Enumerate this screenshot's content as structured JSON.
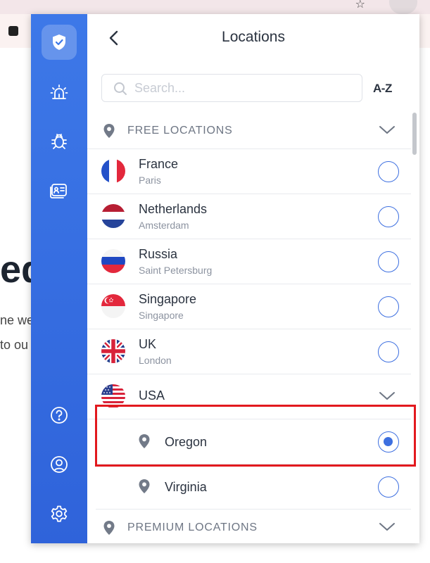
{
  "header": {
    "title": "Locations"
  },
  "search": {
    "placeholder": "Search..."
  },
  "sort": {
    "label": "A-Z"
  },
  "sidebar": {
    "items": [
      {
        "name": "shield-check-icon",
        "active": true
      },
      {
        "name": "alarm-icon",
        "active": false
      },
      {
        "name": "bug-icon",
        "active": false
      },
      {
        "name": "id-card-icon",
        "active": false
      },
      {
        "name": "help-icon",
        "active": false
      },
      {
        "name": "account-icon",
        "active": false
      },
      {
        "name": "settings-icon",
        "active": false
      }
    ]
  },
  "sections": {
    "free": {
      "label": "FREE LOCATIONS"
    },
    "premium": {
      "label": "PREMIUM LOCATIONS"
    }
  },
  "locations": [
    {
      "country": "France",
      "city": "Paris",
      "selected": false
    },
    {
      "country": "Netherlands",
      "city": "Amsterdam",
      "selected": false
    },
    {
      "country": "Russia",
      "city": "Saint Petersburg",
      "selected": false
    },
    {
      "country": "Singapore",
      "city": "Singapore",
      "selected": false
    },
    {
      "country": "UK",
      "city": "London",
      "selected": false
    }
  ],
  "usa": {
    "country": "USA",
    "regions": [
      {
        "name": "Oregon",
        "selected": true
      },
      {
        "name": "Virginia",
        "selected": false
      }
    ]
  },
  "colors": {
    "accent": "#3d6fe0",
    "sidebar": "#3d78e8",
    "highlight": "#e2191e"
  },
  "background_page": {
    "heading_fragment": "ed",
    "line1": "ne we",
    "line2": "to ou"
  }
}
